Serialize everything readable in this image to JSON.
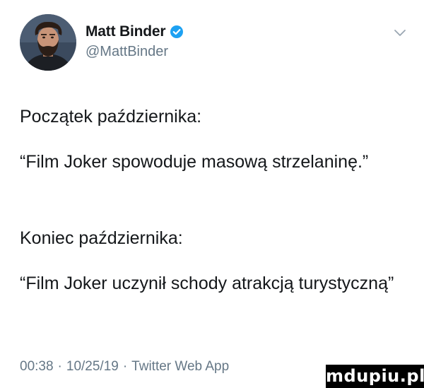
{
  "author": {
    "display_name": "Matt Binder",
    "handle": "@MattBinder",
    "verified": true,
    "avatar_icon": "bearded-man-avatar"
  },
  "tweet": {
    "lines": [
      "Początek października:",
      "“Film Joker spowoduje masową strzelaninę.”",
      "Koniec października:",
      "“Film Joker uczynił schody atrakcją turystyczną”"
    ]
  },
  "meta": {
    "time": "00:38",
    "date": "10/25/19",
    "source": "Twitter Web App",
    "separator": "·"
  },
  "watermark": {
    "text": "mdupiu.pl"
  },
  "colors": {
    "text": "#14171a",
    "secondary": "#657786",
    "verified_blue": "#1da1f2",
    "watermark_bg": "#000000"
  },
  "icons": {
    "verified": "verified-badge-icon",
    "caret": "chevron-down-icon"
  }
}
